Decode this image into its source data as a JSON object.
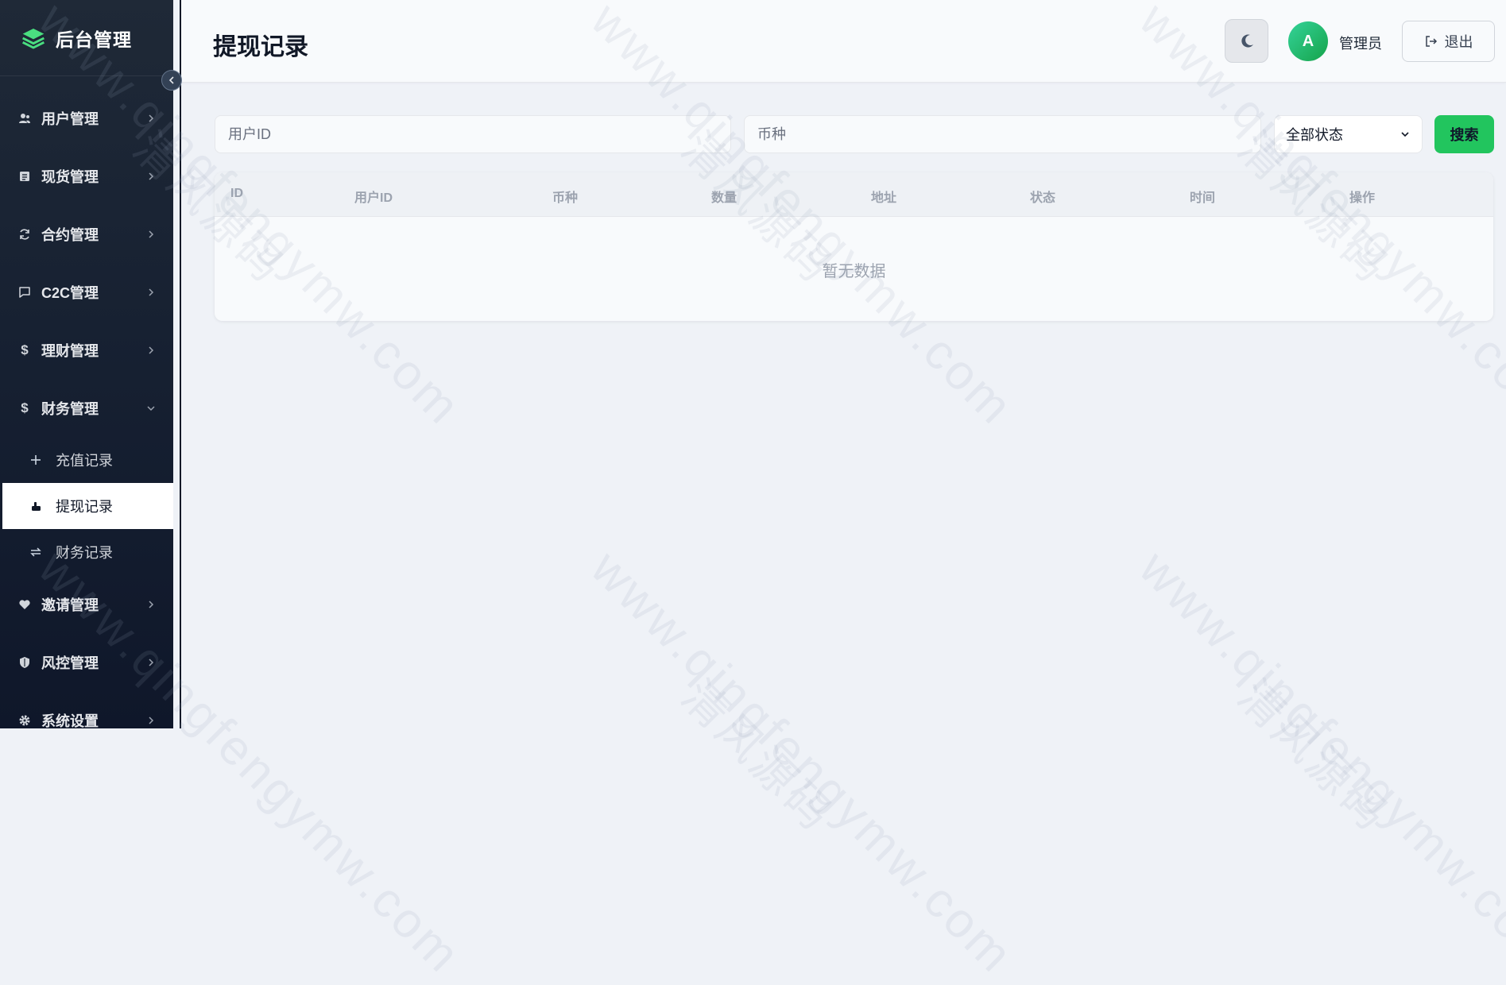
{
  "sidebar": {
    "brand": "后台管理",
    "items": [
      {
        "label": "用户管理",
        "icon": "users-icon"
      },
      {
        "label": "现货管理",
        "icon": "list-icon"
      },
      {
        "label": "合约管理",
        "icon": "refresh-icon"
      },
      {
        "label": "C2C管理",
        "icon": "chat-icon"
      },
      {
        "label": "理财管理",
        "icon": "dollar-icon"
      },
      {
        "label": "财务管理",
        "icon": "dollar-icon",
        "expanded": true
      }
    ],
    "subitems": [
      {
        "label": "充值记录",
        "icon": "plus-icon"
      },
      {
        "label": "提现记录",
        "icon": "hand-icon",
        "active": true
      },
      {
        "label": "财务记录",
        "icon": "swap-icon"
      }
    ],
    "items_bottom": [
      {
        "label": "邀请管理",
        "icon": "heart-icon"
      },
      {
        "label": "风控管理",
        "icon": "shield-icon"
      },
      {
        "label": "系统设置",
        "icon": "gear-icon"
      }
    ]
  },
  "header": {
    "title": "提现记录",
    "avatar_letter": "A",
    "username": "管理员",
    "logout_label": "退出"
  },
  "filters": {
    "user_id_placeholder": "用户ID",
    "currency_placeholder": "币种",
    "status_selected": "全部状态",
    "search_label": "搜索"
  },
  "table": {
    "columns": [
      "ID",
      "用户ID",
      "币种",
      "数量",
      "地址",
      "状态",
      "时间",
      "操作"
    ],
    "empty_text": "暂无数据"
  },
  "watermark": {
    "url": "www.qingfengymw.com",
    "name": "清风源码"
  },
  "colors": {
    "accent": "#22c55e",
    "sidebar_bg": "#1f2937",
    "page_bg": "#eff2f7"
  }
}
